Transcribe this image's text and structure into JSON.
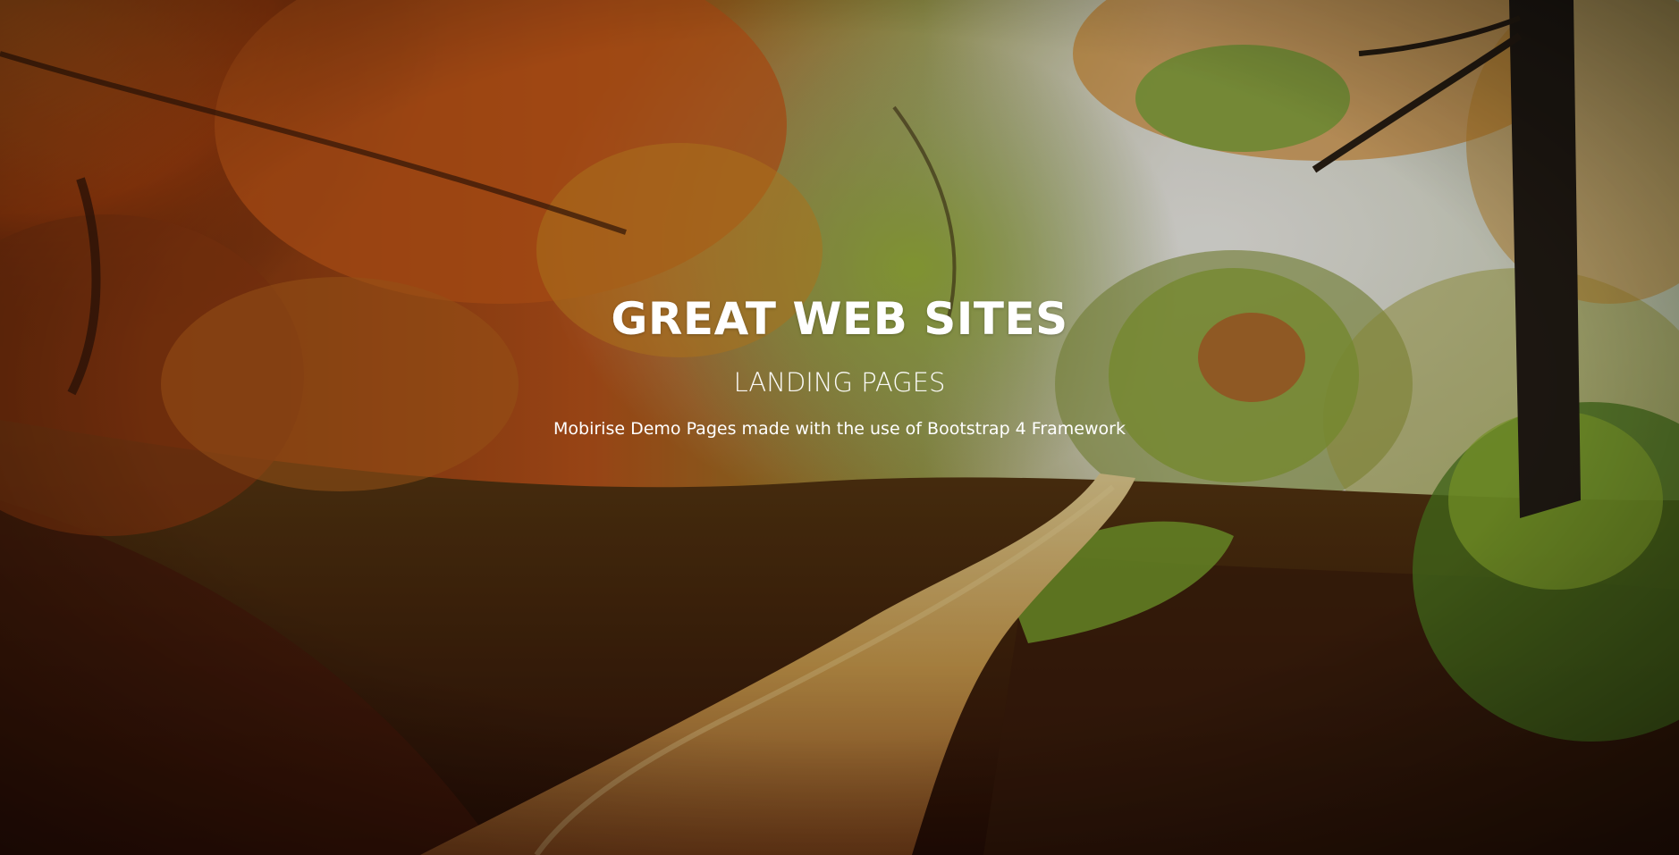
{
  "hero": {
    "title": "GREAT WEB SITES",
    "subtitle": "LANDING PAGES",
    "text": "Mobirise Demo Pages made with the use of Bootstrap 4 Framework"
  },
  "background": {
    "description_icon": "autumn-forest-path-image",
    "colors": {
      "foliage_orange": "#c85a16",
      "foliage_yellow": "#d8a531",
      "foliage_green": "#7d9a3a",
      "path": "#c99a4c",
      "mist": "#e9e7df",
      "trunk": "#2a241c",
      "ground": "#5a2a12"
    }
  }
}
